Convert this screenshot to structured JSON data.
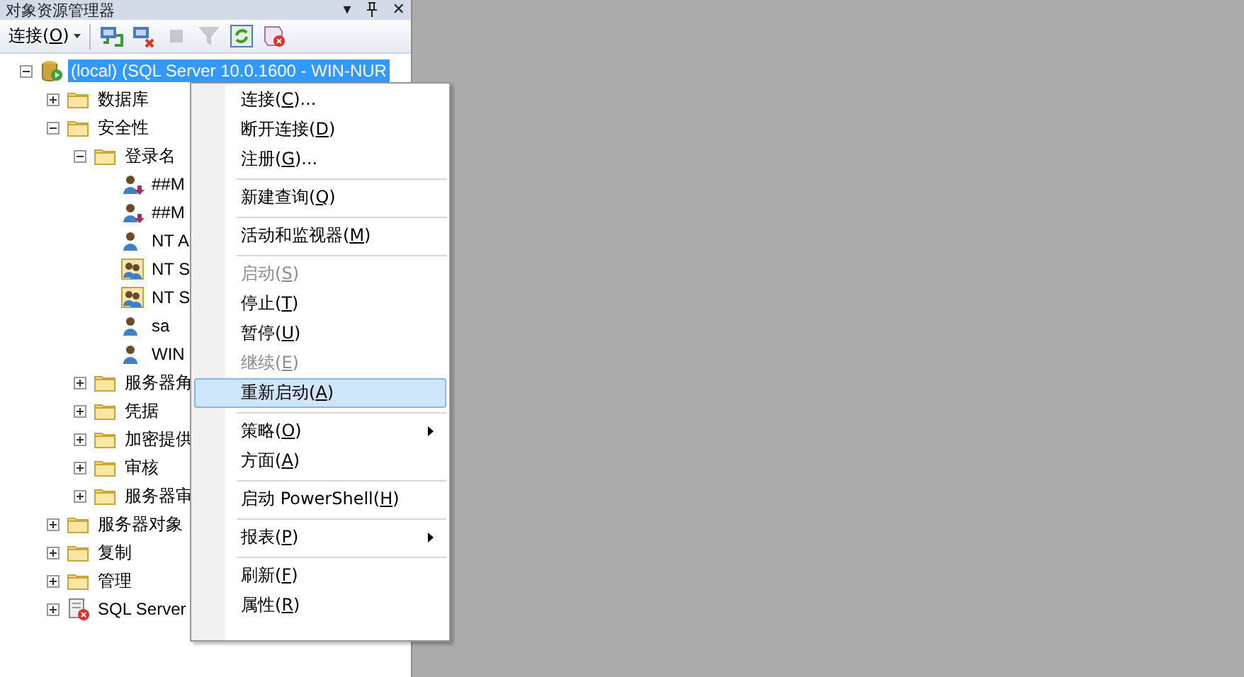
{
  "panel": {
    "title": "对象资源管理器",
    "title_buttons": [
      "▾",
      "✕"
    ]
  },
  "toolbar": {
    "connect": {
      "label": "连接(",
      "key": "O",
      "rest": ")"
    },
    "tools": [
      {
        "kind": "connect",
        "disabled": false
      },
      {
        "kind": "disconnect",
        "disabled": false
      },
      {
        "kind": "stop",
        "disabled": true
      },
      {
        "kind": "filter",
        "disabled": true
      },
      {
        "kind": "refresh",
        "disabled": false
      },
      {
        "kind": "script",
        "disabled": false
      }
    ]
  },
  "tree": [
    {
      "label": "(local) (SQL Server 10.0.1600 - WIN-NUR",
      "kind": "server",
      "expanded": true,
      "selected": true,
      "children": [
        {
          "label": "数据库",
          "kind": "folder",
          "expanded": false,
          "selected": false
        },
        {
          "label": "安全性",
          "kind": "folder",
          "expanded": true,
          "selected": false,
          "children": [
            {
              "label": "登录名",
              "kind": "folder",
              "expanded": true,
              "selected": false,
              "children": [
                {
                  "label": "##M",
                  "kind": "user-down",
                  "selected": false
                },
                {
                  "label": "##M",
                  "kind": "user-down",
                  "selected": false
                },
                {
                  "label": "NT A",
                  "kind": "user",
                  "selected": false
                },
                {
                  "label": "NT S",
                  "kind": "group",
                  "selected": false
                },
                {
                  "label": "NT S",
                  "kind": "group",
                  "selected": false
                },
                {
                  "label": "sa",
                  "kind": "user",
                  "selected": false
                },
                {
                  "label": "WIN",
                  "kind": "user",
                  "selected": false
                }
              ]
            },
            {
              "label": "服务器角",
              "kind": "folder",
              "expanded": false,
              "selected": false
            },
            {
              "label": "凭据",
              "kind": "folder",
              "expanded": false,
              "selected": false
            },
            {
              "label": "加密提供",
              "kind": "folder",
              "expanded": false,
              "selected": false
            },
            {
              "label": "审核",
              "kind": "folder",
              "expanded": false,
              "selected": false
            },
            {
              "label": "服务器审",
              "kind": "folder",
              "expanded": false,
              "selected": false
            }
          ]
        },
        {
          "label": "服务器对象",
          "kind": "folder",
          "expanded": false,
          "selected": false
        },
        {
          "label": "复制",
          "kind": "folder",
          "expanded": false,
          "selected": false
        },
        {
          "label": "管理",
          "kind": "folder",
          "expanded": false,
          "selected": false
        },
        {
          "label": "SQL Server",
          "kind": "agent",
          "expanded": false,
          "selected": false
        }
      ]
    }
  ],
  "context_menu": [
    {
      "kind": "item",
      "label": "连接(",
      "key": "C",
      "rest": ")...",
      "disabled": false,
      "selected": false,
      "submenu": false
    },
    {
      "kind": "item",
      "label": "断开连接(",
      "key": "D",
      "rest": ")",
      "disabled": false,
      "selected": false,
      "submenu": false
    },
    {
      "kind": "item",
      "label": "注册(",
      "key": "G",
      "rest": ")...",
      "disabled": false,
      "selected": false,
      "submenu": false
    },
    {
      "kind": "separator"
    },
    {
      "kind": "item",
      "label": "新建查询(",
      "key": "Q",
      "rest": ")",
      "disabled": false,
      "selected": false,
      "submenu": false
    },
    {
      "kind": "separator"
    },
    {
      "kind": "item",
      "label": "活动和监视器(",
      "key": "M",
      "rest": ")",
      "disabled": false,
      "selected": false,
      "submenu": false
    },
    {
      "kind": "separator"
    },
    {
      "kind": "item",
      "label": "启动(",
      "key": "S",
      "rest": ")",
      "disabled": true,
      "selected": false,
      "submenu": false
    },
    {
      "kind": "item",
      "label": "停止(",
      "key": "T",
      "rest": ")",
      "disabled": false,
      "selected": false,
      "submenu": false
    },
    {
      "kind": "item",
      "label": "暂停(",
      "key": "U",
      "rest": ")",
      "disabled": false,
      "selected": false,
      "submenu": false
    },
    {
      "kind": "item",
      "label": "继续(",
      "key": "E",
      "rest": ")",
      "disabled": true,
      "selected": false,
      "submenu": false
    },
    {
      "kind": "item",
      "label": "重新启动(",
      "key": "A",
      "rest": ")",
      "disabled": false,
      "selected": true,
      "submenu": false
    },
    {
      "kind": "separator"
    },
    {
      "kind": "item",
      "label": "策略(",
      "key": "O",
      "rest": ")",
      "disabled": false,
      "selected": false,
      "submenu": true
    },
    {
      "kind": "item",
      "label": "方面(",
      "key": "A",
      "rest": ")",
      "disabled": false,
      "selected": false,
      "submenu": false
    },
    {
      "kind": "separator"
    },
    {
      "kind": "item",
      "label": "启动 PowerShell(",
      "key": "H",
      "rest": ")",
      "disabled": false,
      "selected": false,
      "submenu": false
    },
    {
      "kind": "separator"
    },
    {
      "kind": "item",
      "label": "报表(",
      "key": "P",
      "rest": ")",
      "disabled": false,
      "selected": false,
      "submenu": true
    },
    {
      "kind": "separator"
    },
    {
      "kind": "item",
      "label": "刷新(",
      "key": "F",
      "rest": ")",
      "disabled": false,
      "selected": false,
      "submenu": false
    },
    {
      "kind": "item",
      "label": "属性(",
      "key": "R",
      "rest": ")",
      "disabled": false,
      "selected": false,
      "submenu": false
    }
  ]
}
